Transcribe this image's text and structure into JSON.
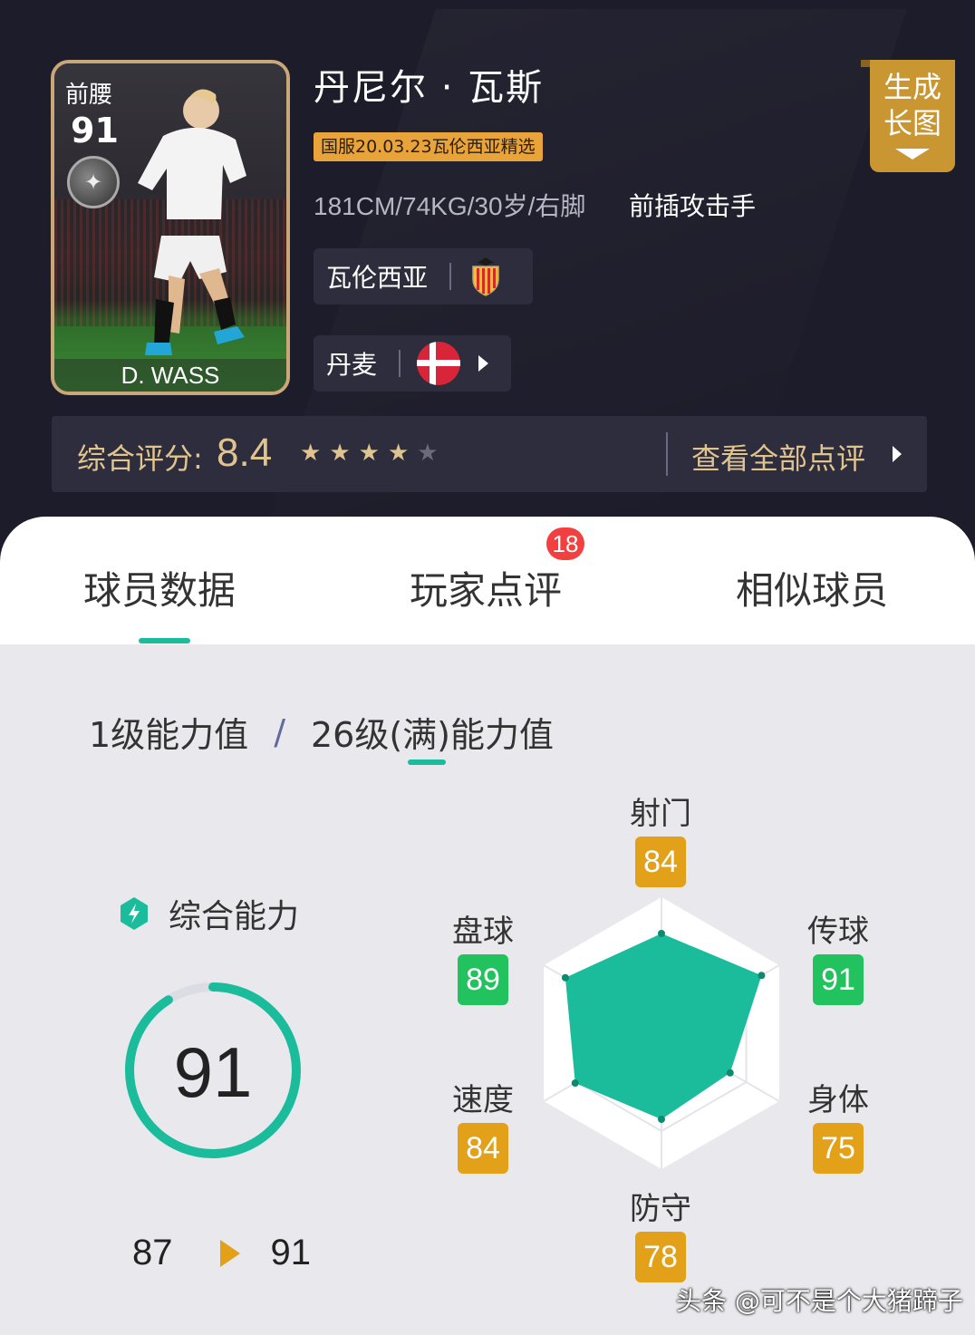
{
  "card": {
    "position": "前腰",
    "rating": "91",
    "name": "D. WASS"
  },
  "player": {
    "name": "丹尼尔 · 瓦斯",
    "edition": "国服20.03.23瓦伦西亚精选",
    "info": "181CM/74KG/30岁/右脚",
    "role": "前插攻击手",
    "club": "瓦伦西亚",
    "nation": "丹麦"
  },
  "generate_button": {
    "line1": "生成",
    "line2": "长图"
  },
  "rating": {
    "label": "综合评分:",
    "value": "8.4",
    "stars": 4,
    "max_stars": 5,
    "view_all": "查看全部点评"
  },
  "tabs": [
    {
      "label": "球员数据",
      "active": true
    },
    {
      "label": "玩家点评",
      "badge": "18"
    },
    {
      "label": "相似球员"
    }
  ],
  "levels": {
    "level1": "1级能力值",
    "separator": "/",
    "max": "26级(满)能力值",
    "selected": "max"
  },
  "overall": {
    "label": "综合能力",
    "value": "91",
    "from": "87",
    "to": "91",
    "gauge_fraction": 0.91
  },
  "stats": [
    {
      "key": "shooting",
      "label": "射门",
      "value": 84,
      "color": "#e3a019"
    },
    {
      "key": "passing",
      "label": "传球",
      "value": 91,
      "color": "#22c35e"
    },
    {
      "key": "physical",
      "label": "身体",
      "value": 75,
      "color": "#e3a019"
    },
    {
      "key": "defense",
      "label": "防守",
      "value": 78,
      "color": "#e3a019"
    },
    {
      "key": "speed",
      "label": "速度",
      "value": 84,
      "color": "#e3a019"
    },
    {
      "key": "dribbling",
      "label": "盘球",
      "value": 89,
      "color": "#22c35e"
    }
  ],
  "colors": {
    "accent": "#1abc9c",
    "gold": "#e0c48f",
    "header_bg": "#1d1c2a"
  },
  "watermark": "头条 @可不是个大猪蹄子"
}
